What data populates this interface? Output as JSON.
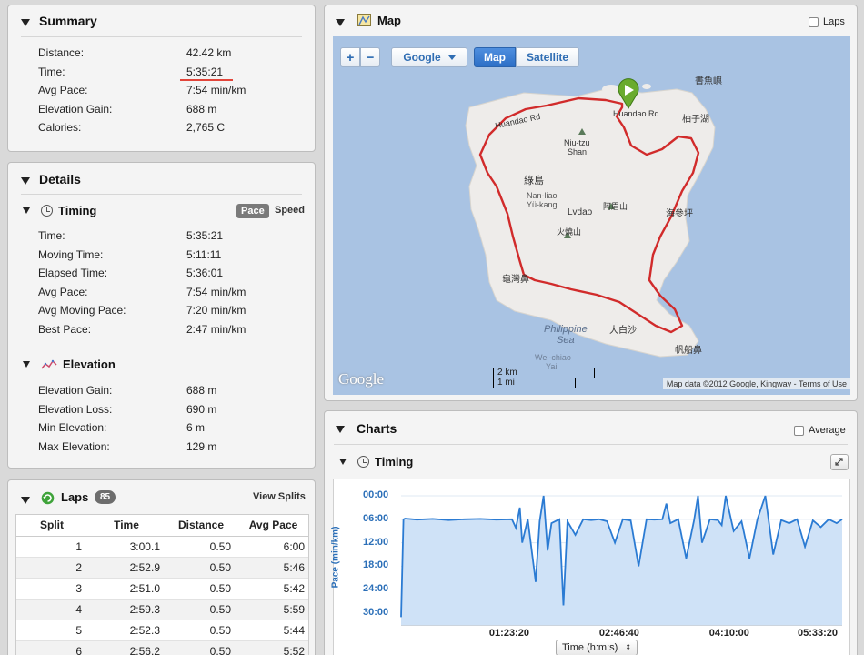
{
  "summary": {
    "title": "Summary",
    "rows": [
      {
        "label": "Distance:",
        "value": "42.42 km"
      },
      {
        "label": "Time:",
        "value": "5:35:21"
      },
      {
        "label": "Avg Pace:",
        "value": "7:54 min/km"
      },
      {
        "label": "Elevation Gain:",
        "value": "688 m"
      },
      {
        "label": "Calories:",
        "value": "2,765 C"
      }
    ]
  },
  "details": {
    "title": "Details",
    "timing": {
      "title": "Timing",
      "pace_btn": "Pace",
      "speed_btn": "Speed",
      "rows": [
        {
          "label": "Time:",
          "value": "5:35:21"
        },
        {
          "label": "Moving Time:",
          "value": "5:11:11"
        },
        {
          "label": "Elapsed Time:",
          "value": "5:36:01"
        },
        {
          "label": "Avg Pace:",
          "value": "7:54 min/km"
        },
        {
          "label": "Avg Moving Pace:",
          "value": "7:20 min/km"
        },
        {
          "label": "Best Pace:",
          "value": "2:47 min/km"
        }
      ]
    },
    "elevation": {
      "title": "Elevation",
      "rows": [
        {
          "label": "Elevation Gain:",
          "value": "688 m"
        },
        {
          "label": "Elevation Loss:",
          "value": "690 m"
        },
        {
          "label": "Min Elevation:",
          "value": "6 m"
        },
        {
          "label": "Max Elevation:",
          "value": "129 m"
        }
      ]
    }
  },
  "laps": {
    "title": "Laps",
    "count": "85",
    "view_splits": "View Splits",
    "headers": [
      "Split",
      "Time",
      "Distance",
      "Avg Pace"
    ],
    "rows": [
      [
        "1",
        "3:00.1",
        "0.50",
        "6:00"
      ],
      [
        "2",
        "2:52.9",
        "0.50",
        "5:46"
      ],
      [
        "3",
        "2:51.0",
        "0.50",
        "5:42"
      ],
      [
        "4",
        "2:59.3",
        "0.50",
        "5:59"
      ],
      [
        "5",
        "2:52.3",
        "0.50",
        "5:44"
      ],
      [
        "6",
        "2:56.2",
        "0.50",
        "5:52"
      ]
    ]
  },
  "map": {
    "title": "Map",
    "laps_label": "Laps",
    "zoom_in": "+",
    "zoom_out": "−",
    "provider": "Google",
    "type_map": "Map",
    "type_satellite": "Satellite",
    "google_logo": "Google",
    "scale_km": "2 km",
    "scale_mi": "1 mi",
    "attribution": "Map data ©2012 Google, Kingway - ",
    "terms": "Terms of Use",
    "labels": {
      "l1": "Niu-tzu",
      "l2": "Shan",
      "l3": "綠島",
      "l4": "Nan-liao",
      "l5": "Yü-kang",
      "l6": "Lvdao",
      "l7": "阿眉山",
      "l8": "火燒山",
      "l9": "Philippine",
      "l10": "Sea",
      "l11": "Wei-chiao",
      "l12": "Yai",
      "l13": "大白沙",
      "l14": "帆船鼻",
      "l15": "柚子湖",
      "l16": "Huandao Rd",
      "l17": "Huandao Rd",
      "l18": "書魚嶼",
      "l19": "海參坪",
      "l20": "龜灣鼻"
    }
  },
  "charts": {
    "title": "Charts",
    "average_label": "Average",
    "timing_title": "Timing",
    "x_selector": "Time (h:m:s)"
  },
  "chart_data": {
    "type": "area",
    "title": "",
    "xlabel": "Time (h:m:s)",
    "ylabel": "Pace (min/km)",
    "y_ticks": [
      "00:00",
      "06:00",
      "12:00",
      "18:00",
      "24:00",
      "30:00"
    ],
    "x_ticks": [
      "01:23:20",
      "02:46:40",
      "04:10:00",
      "05:33:20"
    ],
    "ylim": [
      0,
      33
    ],
    "y_inverted": true,
    "xlim_hours": [
      0,
      5.57
    ],
    "color": "#2b7bd3",
    "fill": "#cfe2f7",
    "series": [
      {
        "x_hours": [
          0.0,
          0.03,
          0.05,
          0.2,
          0.4,
          0.6,
          0.8,
          1.0,
          1.2,
          1.4,
          1.45,
          1.5,
          1.53,
          1.6,
          1.7,
          1.75,
          1.8,
          1.85,
          1.9,
          2.0,
          2.05,
          2.1,
          2.2,
          2.3,
          2.4,
          2.5,
          2.6,
          2.7,
          2.8,
          2.9,
          3.0,
          3.1,
          3.2,
          3.3,
          3.35,
          3.4,
          3.5,
          3.6,
          3.7,
          3.75,
          3.8,
          3.9,
          4.0,
          4.05,
          4.1,
          4.2,
          4.3,
          4.4,
          4.5,
          4.6,
          4.7,
          4.8,
          4.9,
          5.0,
          5.1,
          5.2,
          5.3,
          5.4,
          5.5,
          5.57
        ],
        "pace_min": [
          31,
          6.0,
          5.8,
          6.1,
          5.9,
          6.2,
          6.0,
          5.9,
          6.1,
          6.0,
          8.2,
          3.0,
          12.0,
          6.0,
          22.0,
          6.5,
          0.0,
          14.0,
          7.0,
          6.0,
          28.0,
          6.5,
          10.0,
          6.0,
          6.2,
          6.0,
          6.5,
          12.0,
          6.0,
          6.3,
          18.0,
          6.0,
          6.1,
          6.0,
          2.0,
          7.0,
          6.0,
          16.0,
          6.2,
          0.0,
          12.0,
          6.0,
          6.2,
          7.5,
          0.0,
          9.0,
          6.5,
          16.0,
          6.0,
          0.0,
          15.0,
          6.2,
          7.0,
          6.0,
          13.0,
          6.3,
          8.0,
          6.0,
          7.0,
          6.0
        ]
      }
    ]
  }
}
